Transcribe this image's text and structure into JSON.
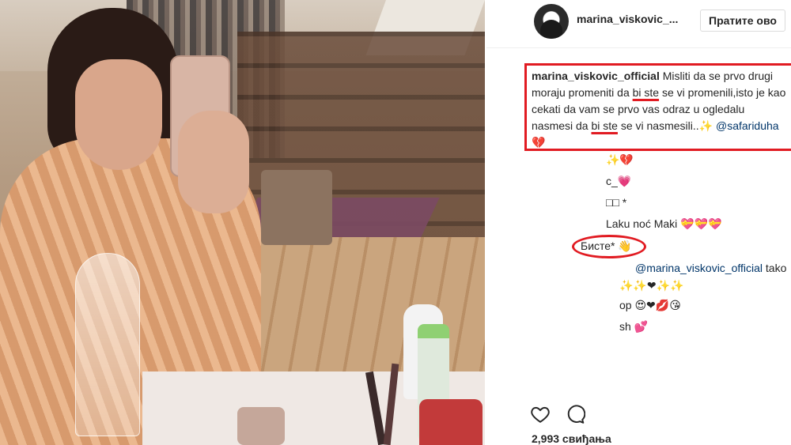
{
  "post": {
    "photo_alt": "selfie-photo",
    "username": "marina_viskovic_...",
    "follow_label": "Пратите ово",
    "caption": {
      "author": "marina_viskovic_official",
      "part1": " Misliti da se prvo drugi moraju promeniti da ",
      "highlight1": "bi ste",
      "part2": " se vi promenili,isto je kao cekati da vam se prvo vas odraz u ogledalu nasmesi da ",
      "highlight2": "bi ste",
      "part3": " se vi nasmesili..✨ ",
      "mention": "@safariduha",
      "emoji": "💔"
    },
    "comments": [
      {
        "text": "✨💔"
      },
      {
        "text": "c_💗"
      },
      {
        "text": "□□ *"
      },
      {
        "text": "Laku noć Maki 💝💝💝"
      },
      {
        "text": "Бисте* 👋"
      },
      {
        "mention": "@marina_viskovic_official",
        "text": " tako"
      },
      {
        "text": "✨✨❤✨✨"
      },
      {
        "text": "op 😍❤💋😘"
      },
      {
        "text": "sh 💕"
      }
    ],
    "likes_label": "2,993 свиђања"
  },
  "icons": {
    "like": "heart-icon",
    "comment": "comment-bubble-icon"
  },
  "colors": {
    "annotation_red": "#e11b22",
    "mention_blue": "#003569",
    "text": "#262626"
  }
}
